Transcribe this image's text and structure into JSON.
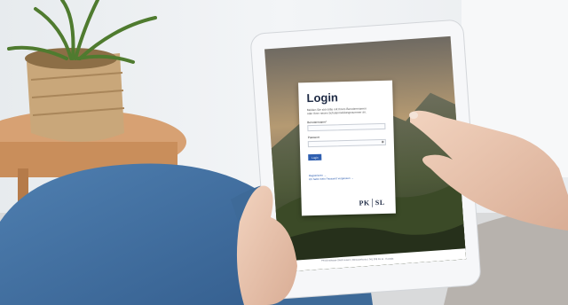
{
  "login": {
    "title": "Login",
    "intro": "Melden Sie sich bitte mit Ihrem Benutzernamen oder Ihrer neuen Schulanmeldungsnummer an.",
    "username_label": "Benutzername*",
    "password_label": "Passwort",
    "submit_label": "Login",
    "register_link": "Registrieren →",
    "forgot_link": "Ich habe mein Passwort vergessen →",
    "logo_text": "PK│SL"
  },
  "footer": {
    "text": "Pensionskasse Stadt Luzern | Benutzerkonto | 041 208 81 11 · Kontakt"
  },
  "colors": {
    "accent": "#2f5fb0",
    "card": "#ffffff",
    "tablet_frame": "#f6f7f9"
  }
}
